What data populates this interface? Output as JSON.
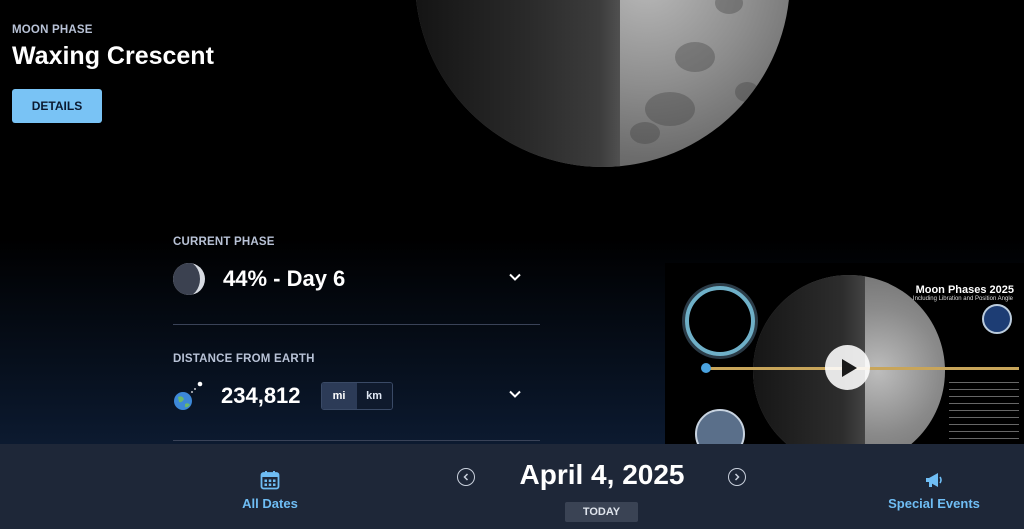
{
  "header": {
    "eyebrow": "MOON PHASE",
    "title": "Waxing Crescent",
    "details_label": "DETAILS"
  },
  "phase": {
    "label": "CURRENT PHASE",
    "value": "44% - Day 6",
    "icon": "moon-phase-icon",
    "expand_icon": "chevron-down-icon"
  },
  "distance": {
    "label": "DISTANCE FROM EARTH",
    "value": "234,812",
    "icon": "earth-moon-icon",
    "units": [
      "mi",
      "km"
    ],
    "selected_unit": "mi",
    "expand_icon": "chevron-down-icon"
  },
  "video": {
    "title": "Moon Phases 2025",
    "subtitle": "Including Libration and Position Angle",
    "play_icon": "play-icon"
  },
  "footer": {
    "all_dates_label": "All Dates",
    "all_dates_icon": "calendar-icon",
    "date": "April 4, 2025",
    "today_label": "TODAY",
    "prev_icon": "chevron-left-icon",
    "next_icon": "chevron-right-icon",
    "special_events_label": "Special Events",
    "special_events_icon": "megaphone-icon"
  },
  "colors": {
    "accent": "#79c3f5",
    "footer_bg": "#1e2738",
    "link": "#6fbdf4"
  }
}
